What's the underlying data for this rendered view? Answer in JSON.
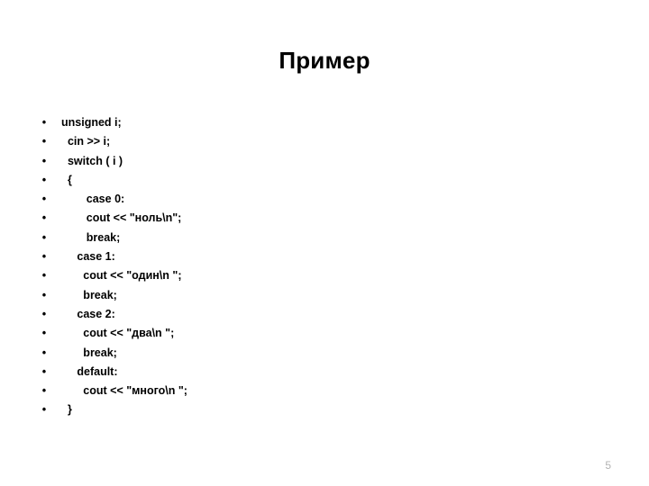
{
  "slide": {
    "title": "Пример",
    "page_number": "5",
    "bullet_glyph": "•",
    "colors": {
      "background": "#ffffff",
      "text": "#000000",
      "page_number": "#b3b3b3"
    },
    "lines": [
      {
        "text": "unsigned i;"
      },
      {
        "text": "  cin >> i;"
      },
      {
        "text": "  switch ( i )"
      },
      {
        "text": "  {"
      },
      {
        "text": "        case 0:"
      },
      {
        "text": "        cout << \"ноль\\n\";"
      },
      {
        "text": "        break;"
      },
      {
        "text": "     case 1:"
      },
      {
        "text": "       cout << \"один\\n \";"
      },
      {
        "text": "       break;"
      },
      {
        "text": "     case 2:"
      },
      {
        "text": "       cout << \"два\\n \";"
      },
      {
        "text": "       break;"
      },
      {
        "text": "     default:"
      },
      {
        "text": "       cout << \"много\\n \";"
      },
      {
        "text": "  }"
      }
    ]
  }
}
